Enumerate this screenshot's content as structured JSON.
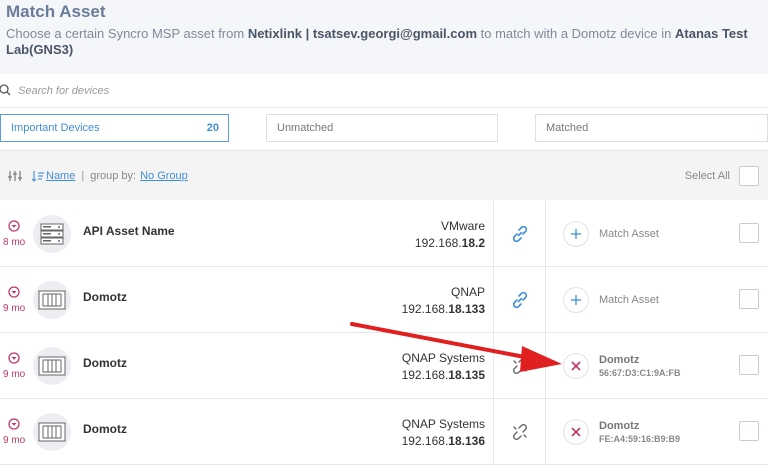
{
  "header": {
    "title": "Match Asset",
    "desc_pre": "Choose a certain Syncro MSP asset from ",
    "desc_source": "Netixlink | tsatsev.georgi@gmail.com",
    "desc_mid": " to match with a Domotz device in ",
    "desc_target": "Atanas Test Lab(GNS3)"
  },
  "search": {
    "placeholder": "Search for devices"
  },
  "filters": {
    "important": {
      "label": "Important Devices",
      "count": "20"
    },
    "unmatched": {
      "label": "Unmatched"
    },
    "matched": {
      "label": "Matched"
    }
  },
  "toolbar": {
    "sort_label": "Name",
    "group_by_label": "group by:",
    "group_value": "No Group",
    "select_all": "Select All"
  },
  "rows": [
    {
      "age": "8 mo",
      "name": "API Asset Name",
      "vendor": "VMware",
      "ip_prefix": "192.168.",
      "ip_bold": "18.2",
      "status": "unmatched",
      "match_label": "Match Asset",
      "device_name": "",
      "device_mac": ""
    },
    {
      "age": "9 mo",
      "name": "Domotz",
      "vendor": "QNAP",
      "ip_prefix": "192.168.",
      "ip_bold": "18.133",
      "status": "unmatched",
      "match_label": "Match Asset",
      "device_name": "",
      "device_mac": ""
    },
    {
      "age": "9 mo",
      "name": "Domotz",
      "vendor": "QNAP Systems",
      "ip_prefix": "192.168.",
      "ip_bold": "18.135",
      "status": "matched",
      "match_label": "",
      "device_name": "Domotz",
      "device_mac": "56:67:D3:C1:9A:FB"
    },
    {
      "age": "9 mo",
      "name": "Domotz",
      "vendor": "QNAP Systems",
      "ip_prefix": "192.168.",
      "ip_bold": "18.136",
      "status": "matched",
      "match_label": "",
      "device_name": "Domotz",
      "device_mac": "FE:A4:59:16:B9:B9"
    }
  ],
  "colors": {
    "accent": "#3f8fd8",
    "alert": "#c0386b",
    "arrow": "#e02020"
  }
}
